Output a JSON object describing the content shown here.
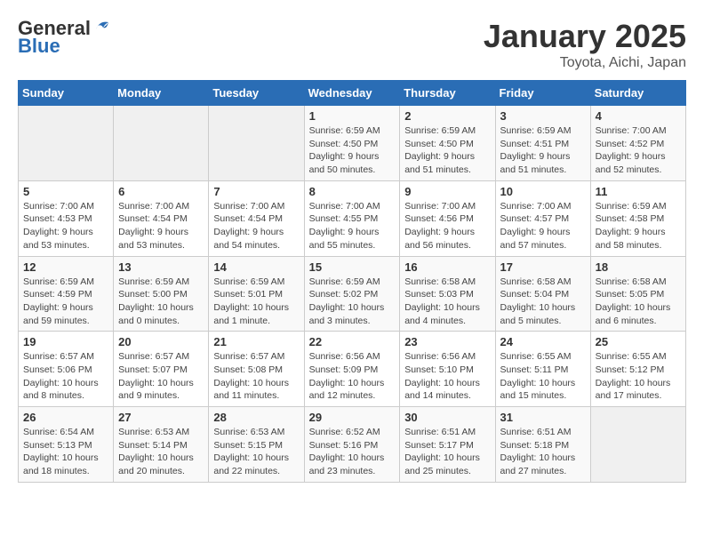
{
  "header": {
    "logo_line1": "General",
    "logo_line2": "Blue",
    "title": "January 2025",
    "subtitle": "Toyota, Aichi, Japan"
  },
  "weekdays": [
    "Sunday",
    "Monday",
    "Tuesday",
    "Wednesday",
    "Thursday",
    "Friday",
    "Saturday"
  ],
  "weeks": [
    [
      {
        "day": "",
        "detail": ""
      },
      {
        "day": "",
        "detail": ""
      },
      {
        "day": "",
        "detail": ""
      },
      {
        "day": "1",
        "detail": "Sunrise: 6:59 AM\nSunset: 4:50 PM\nDaylight: 9 hours\nand 50 minutes."
      },
      {
        "day": "2",
        "detail": "Sunrise: 6:59 AM\nSunset: 4:50 PM\nDaylight: 9 hours\nand 51 minutes."
      },
      {
        "day": "3",
        "detail": "Sunrise: 6:59 AM\nSunset: 4:51 PM\nDaylight: 9 hours\nand 51 minutes."
      },
      {
        "day": "4",
        "detail": "Sunrise: 7:00 AM\nSunset: 4:52 PM\nDaylight: 9 hours\nand 52 minutes."
      }
    ],
    [
      {
        "day": "5",
        "detail": "Sunrise: 7:00 AM\nSunset: 4:53 PM\nDaylight: 9 hours\nand 53 minutes."
      },
      {
        "day": "6",
        "detail": "Sunrise: 7:00 AM\nSunset: 4:54 PM\nDaylight: 9 hours\nand 53 minutes."
      },
      {
        "day": "7",
        "detail": "Sunrise: 7:00 AM\nSunset: 4:54 PM\nDaylight: 9 hours\nand 54 minutes."
      },
      {
        "day": "8",
        "detail": "Sunrise: 7:00 AM\nSunset: 4:55 PM\nDaylight: 9 hours\nand 55 minutes."
      },
      {
        "day": "9",
        "detail": "Sunrise: 7:00 AM\nSunset: 4:56 PM\nDaylight: 9 hours\nand 56 minutes."
      },
      {
        "day": "10",
        "detail": "Sunrise: 7:00 AM\nSunset: 4:57 PM\nDaylight: 9 hours\nand 57 minutes."
      },
      {
        "day": "11",
        "detail": "Sunrise: 6:59 AM\nSunset: 4:58 PM\nDaylight: 9 hours\nand 58 minutes."
      }
    ],
    [
      {
        "day": "12",
        "detail": "Sunrise: 6:59 AM\nSunset: 4:59 PM\nDaylight: 9 hours\nand 59 minutes."
      },
      {
        "day": "13",
        "detail": "Sunrise: 6:59 AM\nSunset: 5:00 PM\nDaylight: 10 hours\nand 0 minutes."
      },
      {
        "day": "14",
        "detail": "Sunrise: 6:59 AM\nSunset: 5:01 PM\nDaylight: 10 hours\nand 1 minute."
      },
      {
        "day": "15",
        "detail": "Sunrise: 6:59 AM\nSunset: 5:02 PM\nDaylight: 10 hours\nand 3 minutes."
      },
      {
        "day": "16",
        "detail": "Sunrise: 6:58 AM\nSunset: 5:03 PM\nDaylight: 10 hours\nand 4 minutes."
      },
      {
        "day": "17",
        "detail": "Sunrise: 6:58 AM\nSunset: 5:04 PM\nDaylight: 10 hours\nand 5 minutes."
      },
      {
        "day": "18",
        "detail": "Sunrise: 6:58 AM\nSunset: 5:05 PM\nDaylight: 10 hours\nand 6 minutes."
      }
    ],
    [
      {
        "day": "19",
        "detail": "Sunrise: 6:57 AM\nSunset: 5:06 PM\nDaylight: 10 hours\nand 8 minutes."
      },
      {
        "day": "20",
        "detail": "Sunrise: 6:57 AM\nSunset: 5:07 PM\nDaylight: 10 hours\nand 9 minutes."
      },
      {
        "day": "21",
        "detail": "Sunrise: 6:57 AM\nSunset: 5:08 PM\nDaylight: 10 hours\nand 11 minutes."
      },
      {
        "day": "22",
        "detail": "Sunrise: 6:56 AM\nSunset: 5:09 PM\nDaylight: 10 hours\nand 12 minutes."
      },
      {
        "day": "23",
        "detail": "Sunrise: 6:56 AM\nSunset: 5:10 PM\nDaylight: 10 hours\nand 14 minutes."
      },
      {
        "day": "24",
        "detail": "Sunrise: 6:55 AM\nSunset: 5:11 PM\nDaylight: 10 hours\nand 15 minutes."
      },
      {
        "day": "25",
        "detail": "Sunrise: 6:55 AM\nSunset: 5:12 PM\nDaylight: 10 hours\nand 17 minutes."
      }
    ],
    [
      {
        "day": "26",
        "detail": "Sunrise: 6:54 AM\nSunset: 5:13 PM\nDaylight: 10 hours\nand 18 minutes."
      },
      {
        "day": "27",
        "detail": "Sunrise: 6:53 AM\nSunset: 5:14 PM\nDaylight: 10 hours\nand 20 minutes."
      },
      {
        "day": "28",
        "detail": "Sunrise: 6:53 AM\nSunset: 5:15 PM\nDaylight: 10 hours\nand 22 minutes."
      },
      {
        "day": "29",
        "detail": "Sunrise: 6:52 AM\nSunset: 5:16 PM\nDaylight: 10 hours\nand 23 minutes."
      },
      {
        "day": "30",
        "detail": "Sunrise: 6:51 AM\nSunset: 5:17 PM\nDaylight: 10 hours\nand 25 minutes."
      },
      {
        "day": "31",
        "detail": "Sunrise: 6:51 AM\nSunset: 5:18 PM\nDaylight: 10 hours\nand 27 minutes."
      },
      {
        "day": "",
        "detail": ""
      }
    ]
  ]
}
